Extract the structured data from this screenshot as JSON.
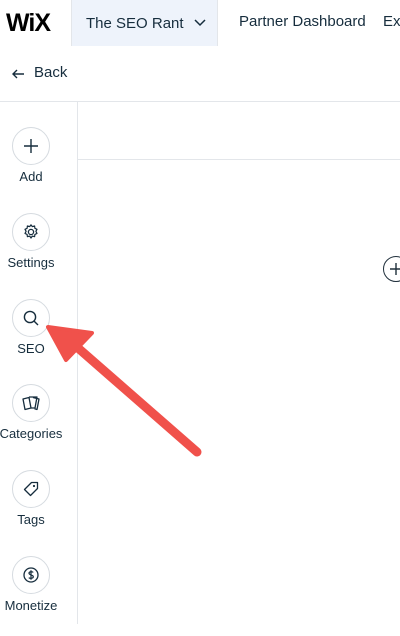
{
  "topbar": {
    "logo": "WiX",
    "site_name": "The SEO Rant",
    "partner_link": "Partner Dashboard",
    "extra_link": "Ex"
  },
  "back": {
    "label": "Back",
    "icon": "arrow-left-icon"
  },
  "sidebar": {
    "items": [
      {
        "label": "Add",
        "icon": "plus-icon"
      },
      {
        "label": "Settings",
        "icon": "gear-icon"
      },
      {
        "label": "SEO",
        "icon": "search-icon"
      },
      {
        "label": "Categories",
        "icon": "categories-icon"
      },
      {
        "label": "Tags",
        "icon": "tag-icon"
      },
      {
        "label": "Monetize",
        "icon": "dollar-icon"
      }
    ]
  },
  "main": {
    "add_icon": "plus-circle-icon"
  },
  "annotation": {
    "color": "#f0514b",
    "points_to": "SEO"
  }
}
